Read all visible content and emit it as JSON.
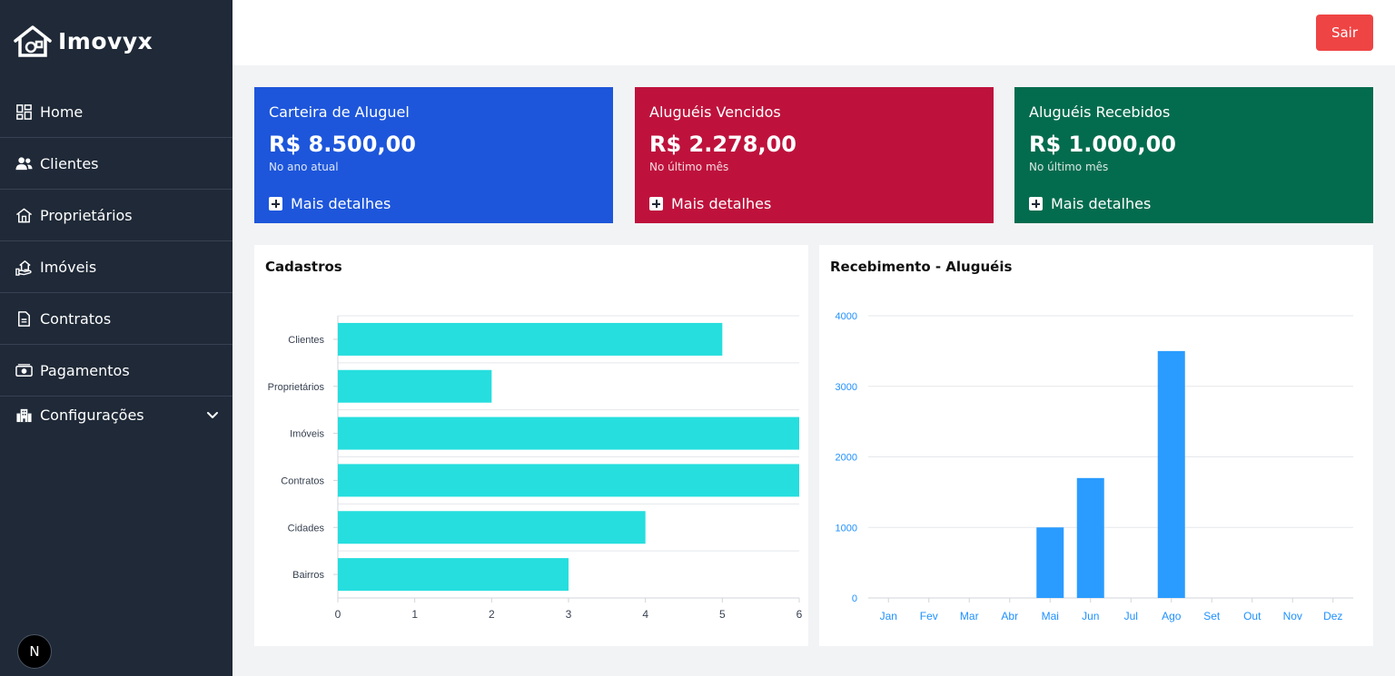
{
  "brand": {
    "name": "Imovyx"
  },
  "sidebar": {
    "items": [
      {
        "label": "Home",
        "icon": "dashboard-icon"
      },
      {
        "label": "Clientes",
        "icon": "users-icon"
      },
      {
        "label": "Proprietários",
        "icon": "house-icon"
      },
      {
        "label": "Imóveis",
        "icon": "property-icon"
      },
      {
        "label": "Contratos",
        "icon": "document-icon"
      },
      {
        "label": "Pagamentos",
        "icon": "money-icon"
      },
      {
        "label": "Configurações",
        "icon": "buildings-icon"
      }
    ],
    "badge": "N"
  },
  "header": {
    "logout_label": "Sair"
  },
  "cards": [
    {
      "title": "Carteira de Aluguel",
      "value": "R$ 8.500,00",
      "sub": "No ano atual",
      "link": "Mais detalhes",
      "color": "#1d56db"
    },
    {
      "title": "Aluguéis Vencidos",
      "value": "R$ 2.278,00",
      "sub": "No último mês",
      "link": "Mais detalhes",
      "color": "#be123c"
    },
    {
      "title": "Aluguéis Recebidos",
      "value": "R$ 1.000,00",
      "sub": "No último mês",
      "link": "Mais detalhes",
      "color": "#046c4e"
    }
  ],
  "panels": {
    "cadastros_title": "Cadastros",
    "recebimento_title": "Recebimento - Aluguéis"
  },
  "chart_data": [
    {
      "type": "bar",
      "orientation": "horizontal",
      "title": "Cadastros",
      "categories": [
        "Clientes",
        "Proprietários",
        "Imóveis",
        "Contratos",
        "Cidades",
        "Bairros"
      ],
      "values": [
        5,
        2,
        6,
        6,
        4,
        3
      ],
      "xlim": [
        0,
        6
      ],
      "xticks": [
        "0",
        "1",
        "2",
        "3",
        "4",
        "5",
        "6"
      ],
      "color": "#26dede",
      "grid": true
    },
    {
      "type": "bar",
      "title": "Recebimento - Aluguéis",
      "categories": [
        "Jan",
        "Fev",
        "Mar",
        "Abr",
        "Mai",
        "Jun",
        "Jul",
        "Ago",
        "Set",
        "Out",
        "Nov",
        "Dez"
      ],
      "values": [
        0,
        0,
        0,
        0,
        1000,
        1700,
        0,
        3500,
        0,
        0,
        0,
        0
      ],
      "ylim": [
        0,
        4000
      ],
      "yticks": [
        "0",
        "1000",
        "2000",
        "3000",
        "4000"
      ],
      "color": "#2a9cff",
      "tick_color": "#1e90ff",
      "grid": true
    }
  ]
}
